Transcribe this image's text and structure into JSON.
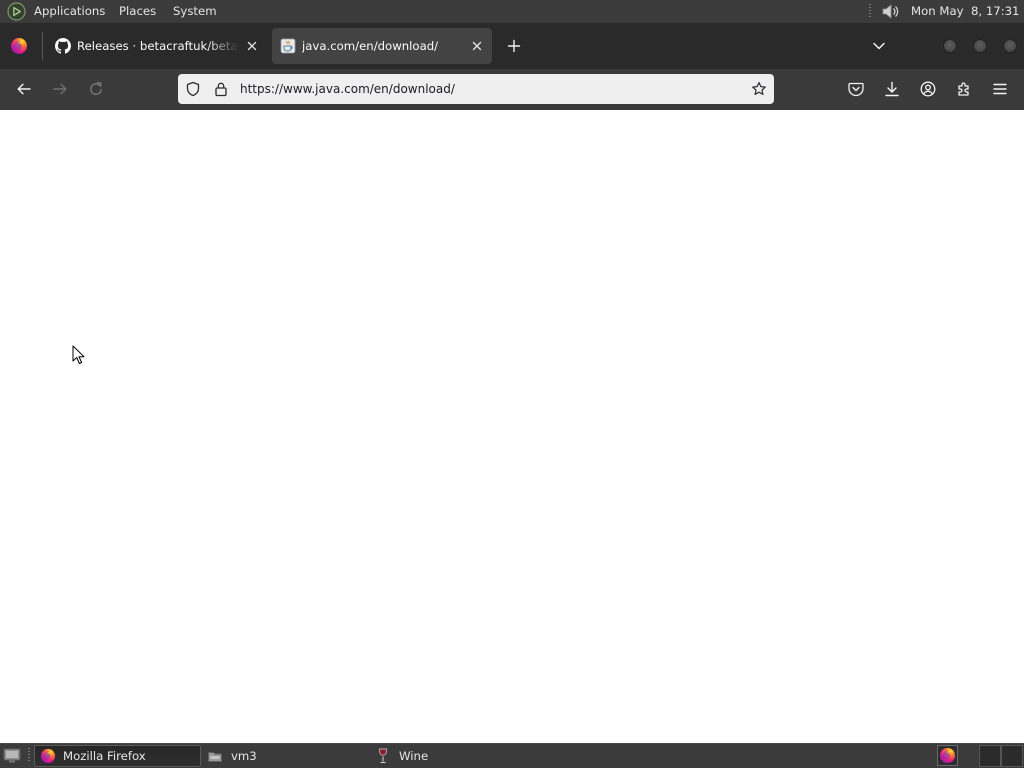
{
  "colors": {
    "panel_bg": "#3b3b3b",
    "panel_text": "#e6e6e6",
    "tabstrip_bg": "#2a2a2a",
    "selected_tab_bg": "#434343",
    "toolbar_bg": "#3a3a3a",
    "urlbar_bg": "#efefef",
    "urlbar_text": "#1c1b22",
    "content_bg": "#ffffff"
  },
  "top_panel": {
    "logo_icon": "mate-logo-icon",
    "menu": [
      "Applications",
      "Places",
      "System"
    ],
    "volume_icon": "speaker-icon",
    "clock": "Mon May  8, 17:31"
  },
  "browser": {
    "app_icon": "firefox-icon",
    "tabs": [
      {
        "title": "Releases · betacraftuk/betac",
        "icon": "github-icon",
        "selected": false
      },
      {
        "title": "java.com/en/download/",
        "icon": "java-icon",
        "selected": true
      }
    ],
    "nav": {
      "back_icon": "back-arrow-icon",
      "forward_icon": "forward-arrow-icon",
      "forward_enabled": false,
      "reload_icon": "reload-icon",
      "reload_enabled": false
    },
    "url": "https://www.java.com/en/download/",
    "toolbar_icons": [
      "pocket-icon",
      "download-icon",
      "account-icon",
      "extensions-icon",
      "menu-icon"
    ]
  },
  "taskbar": {
    "items": [
      {
        "label": "Mozilla Firefox",
        "icon": "firefox-icon",
        "active": true
      },
      {
        "label": "vm3",
        "icon": "folder-icon",
        "active": false
      },
      {
        "label": "Wine",
        "icon": "wine-icon",
        "active": false
      }
    ]
  }
}
